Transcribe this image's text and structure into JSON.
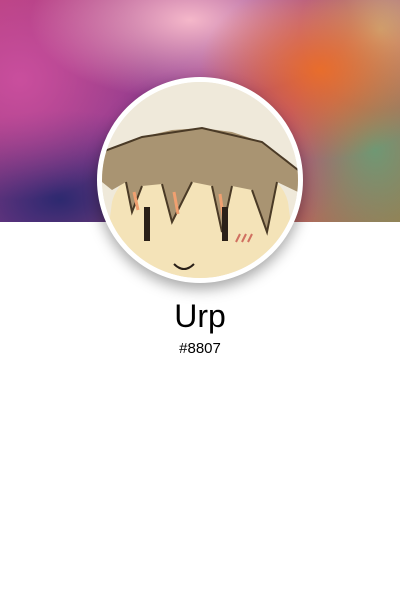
{
  "profile": {
    "username": "Urp",
    "discriminator": "#8807",
    "avatar_icon": "anime-character-avatar"
  },
  "colors": {
    "page_background": "#ffffff",
    "avatar_border": "#ffffff",
    "text": "#000000"
  }
}
